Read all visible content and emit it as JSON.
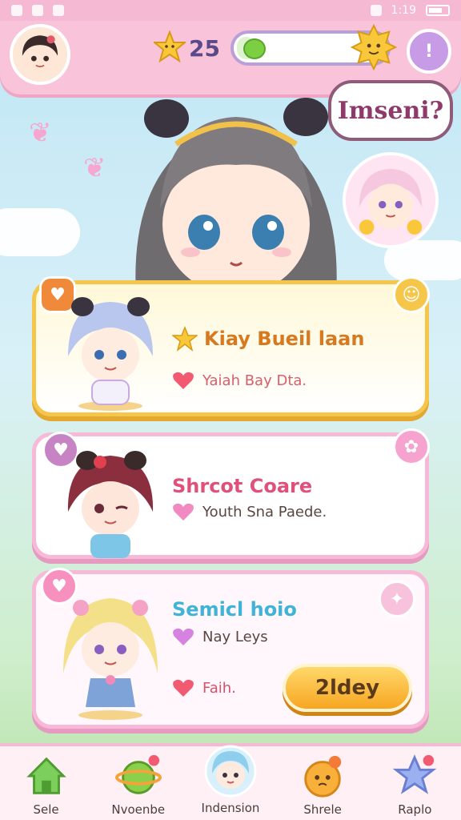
{
  "status_bar": {
    "time": "1:19"
  },
  "top_bar": {
    "star_count": "25",
    "progress_fraction": 0.12,
    "menu_label": "!"
  },
  "hero": {
    "speech_bubble_text": "Imseni?"
  },
  "cards": [
    {
      "title": "Kiay Bueil laan",
      "line1": "Yaiah Bay Dta."
    },
    {
      "title": "Shrcot Coare",
      "line1": "Youth Sna Paede."
    },
    {
      "title": "Semicl hoio",
      "line1": "Nay Leys",
      "line2": "Faih.",
      "button_label": "2ldey"
    }
  ],
  "bottom_nav": {
    "items": [
      {
        "label": "Sele",
        "icon": "home-icon"
      },
      {
        "label": "Nvoenbe",
        "icon": "planet-icon"
      },
      {
        "label": "Indension",
        "icon": "character-icon"
      },
      {
        "label": "Shrele",
        "icon": "flower-icon"
      },
      {
        "label": "Raplo",
        "icon": "star-icon"
      }
    ]
  },
  "colors": {
    "primary_pink": "#f9c3da",
    "gold": "#f6c64a",
    "purple": "#c79be6"
  }
}
